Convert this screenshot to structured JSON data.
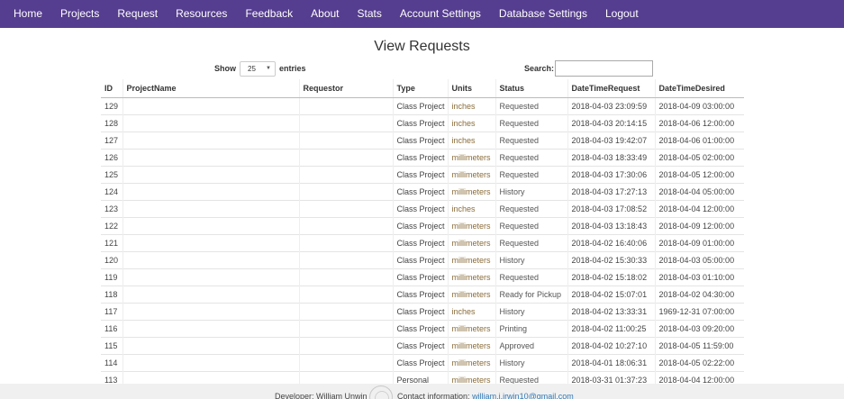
{
  "nav": [
    "Home",
    "Projects",
    "Request",
    "Resources",
    "Feedback",
    "About",
    "Stats",
    "Account Settings",
    "Database Settings",
    "Logout"
  ],
  "page_title": "View Requests",
  "length_menu": {
    "show_label": "Show",
    "value": "25",
    "entries_label": "entries"
  },
  "search": {
    "label": "Search:",
    "value": ""
  },
  "table": {
    "columns": [
      "ID",
      "ProjectName",
      "Requestor",
      "Type",
      "Units",
      "Status",
      "DateTimeRequest",
      "DateTimeDesired"
    ],
    "rows": [
      [
        "129",
        "",
        "",
        "Class Project",
        "inches",
        "Requested",
        "2018-04-03 23:09:59",
        "2018-04-09 03:00:00"
      ],
      [
        "128",
        "",
        "",
        "Class Project",
        "inches",
        "Requested",
        "2018-04-03 20:14:15",
        "2018-04-06 12:00:00"
      ],
      [
        "127",
        "",
        "",
        "Class Project",
        "inches",
        "Requested",
        "2018-04-03 19:42:07",
        "2018-04-06 01:00:00"
      ],
      [
        "126",
        "",
        "",
        "Class Project",
        "millimeters",
        "Requested",
        "2018-04-03 18:33:49",
        "2018-04-05 02:00:00"
      ],
      [
        "125",
        "",
        "",
        "Class Project",
        "millimeters",
        "Requested",
        "2018-04-03 17:30:06",
        "2018-04-05 12:00:00"
      ],
      [
        "124",
        "",
        "",
        "Class Project",
        "millimeters",
        "History",
        "2018-04-03 17:27:13",
        "2018-04-04 05:00:00"
      ],
      [
        "123",
        "",
        "",
        "Class Project",
        "inches",
        "Requested",
        "2018-04-03 17:08:52",
        "2018-04-04 12:00:00"
      ],
      [
        "122",
        "",
        "",
        "Class Project",
        "millimeters",
        "Requested",
        "2018-04-03 13:18:43",
        "2018-04-09 12:00:00"
      ],
      [
        "121",
        "",
        "",
        "Class Project",
        "millimeters",
        "Requested",
        "2018-04-02 16:40:06",
        "2018-04-09 01:00:00"
      ],
      [
        "120",
        "",
        "",
        "Class Project",
        "millimeters",
        "History",
        "2018-04-02 15:30:33",
        "2018-04-03 05:00:00"
      ],
      [
        "119",
        "",
        "",
        "Class Project",
        "millimeters",
        "Requested",
        "2018-04-02 15:18:02",
        "2018-04-03 01:10:00"
      ],
      [
        "118",
        "",
        "",
        "Class Project",
        "millimeters",
        "Ready for Pickup",
        "2018-04-02 15:07:01",
        "2018-04-02 04:30:00"
      ],
      [
        "117",
        "",
        "",
        "Class Project",
        "inches",
        "History",
        "2018-04-02 13:33:31",
        "1969-12-31 07:00:00"
      ],
      [
        "116",
        "",
        "",
        "Class Project",
        "millimeters",
        "Printing",
        "2018-04-02 11:00:25",
        "2018-04-03 09:20:00"
      ],
      [
        "115",
        "",
        "",
        "Class Project",
        "millimeters",
        "Approved",
        "2018-04-02 10:27:10",
        "2018-04-05 11:59:00"
      ],
      [
        "114",
        "",
        "",
        "Class Project",
        "millimeters",
        "History",
        "2018-04-01 18:06:31",
        "2018-04-05 02:22:00"
      ],
      [
        "113",
        "",
        "",
        "Personal",
        "millimeters",
        "Requested",
        "2018-03-31 01:37:23",
        "2018-04-04 12:00:00"
      ]
    ]
  },
  "footer": {
    "developer": "Developer: William  Unwin",
    "contact_label": "Contact information:",
    "email": "william.j.irwin10@gmail.com"
  }
}
